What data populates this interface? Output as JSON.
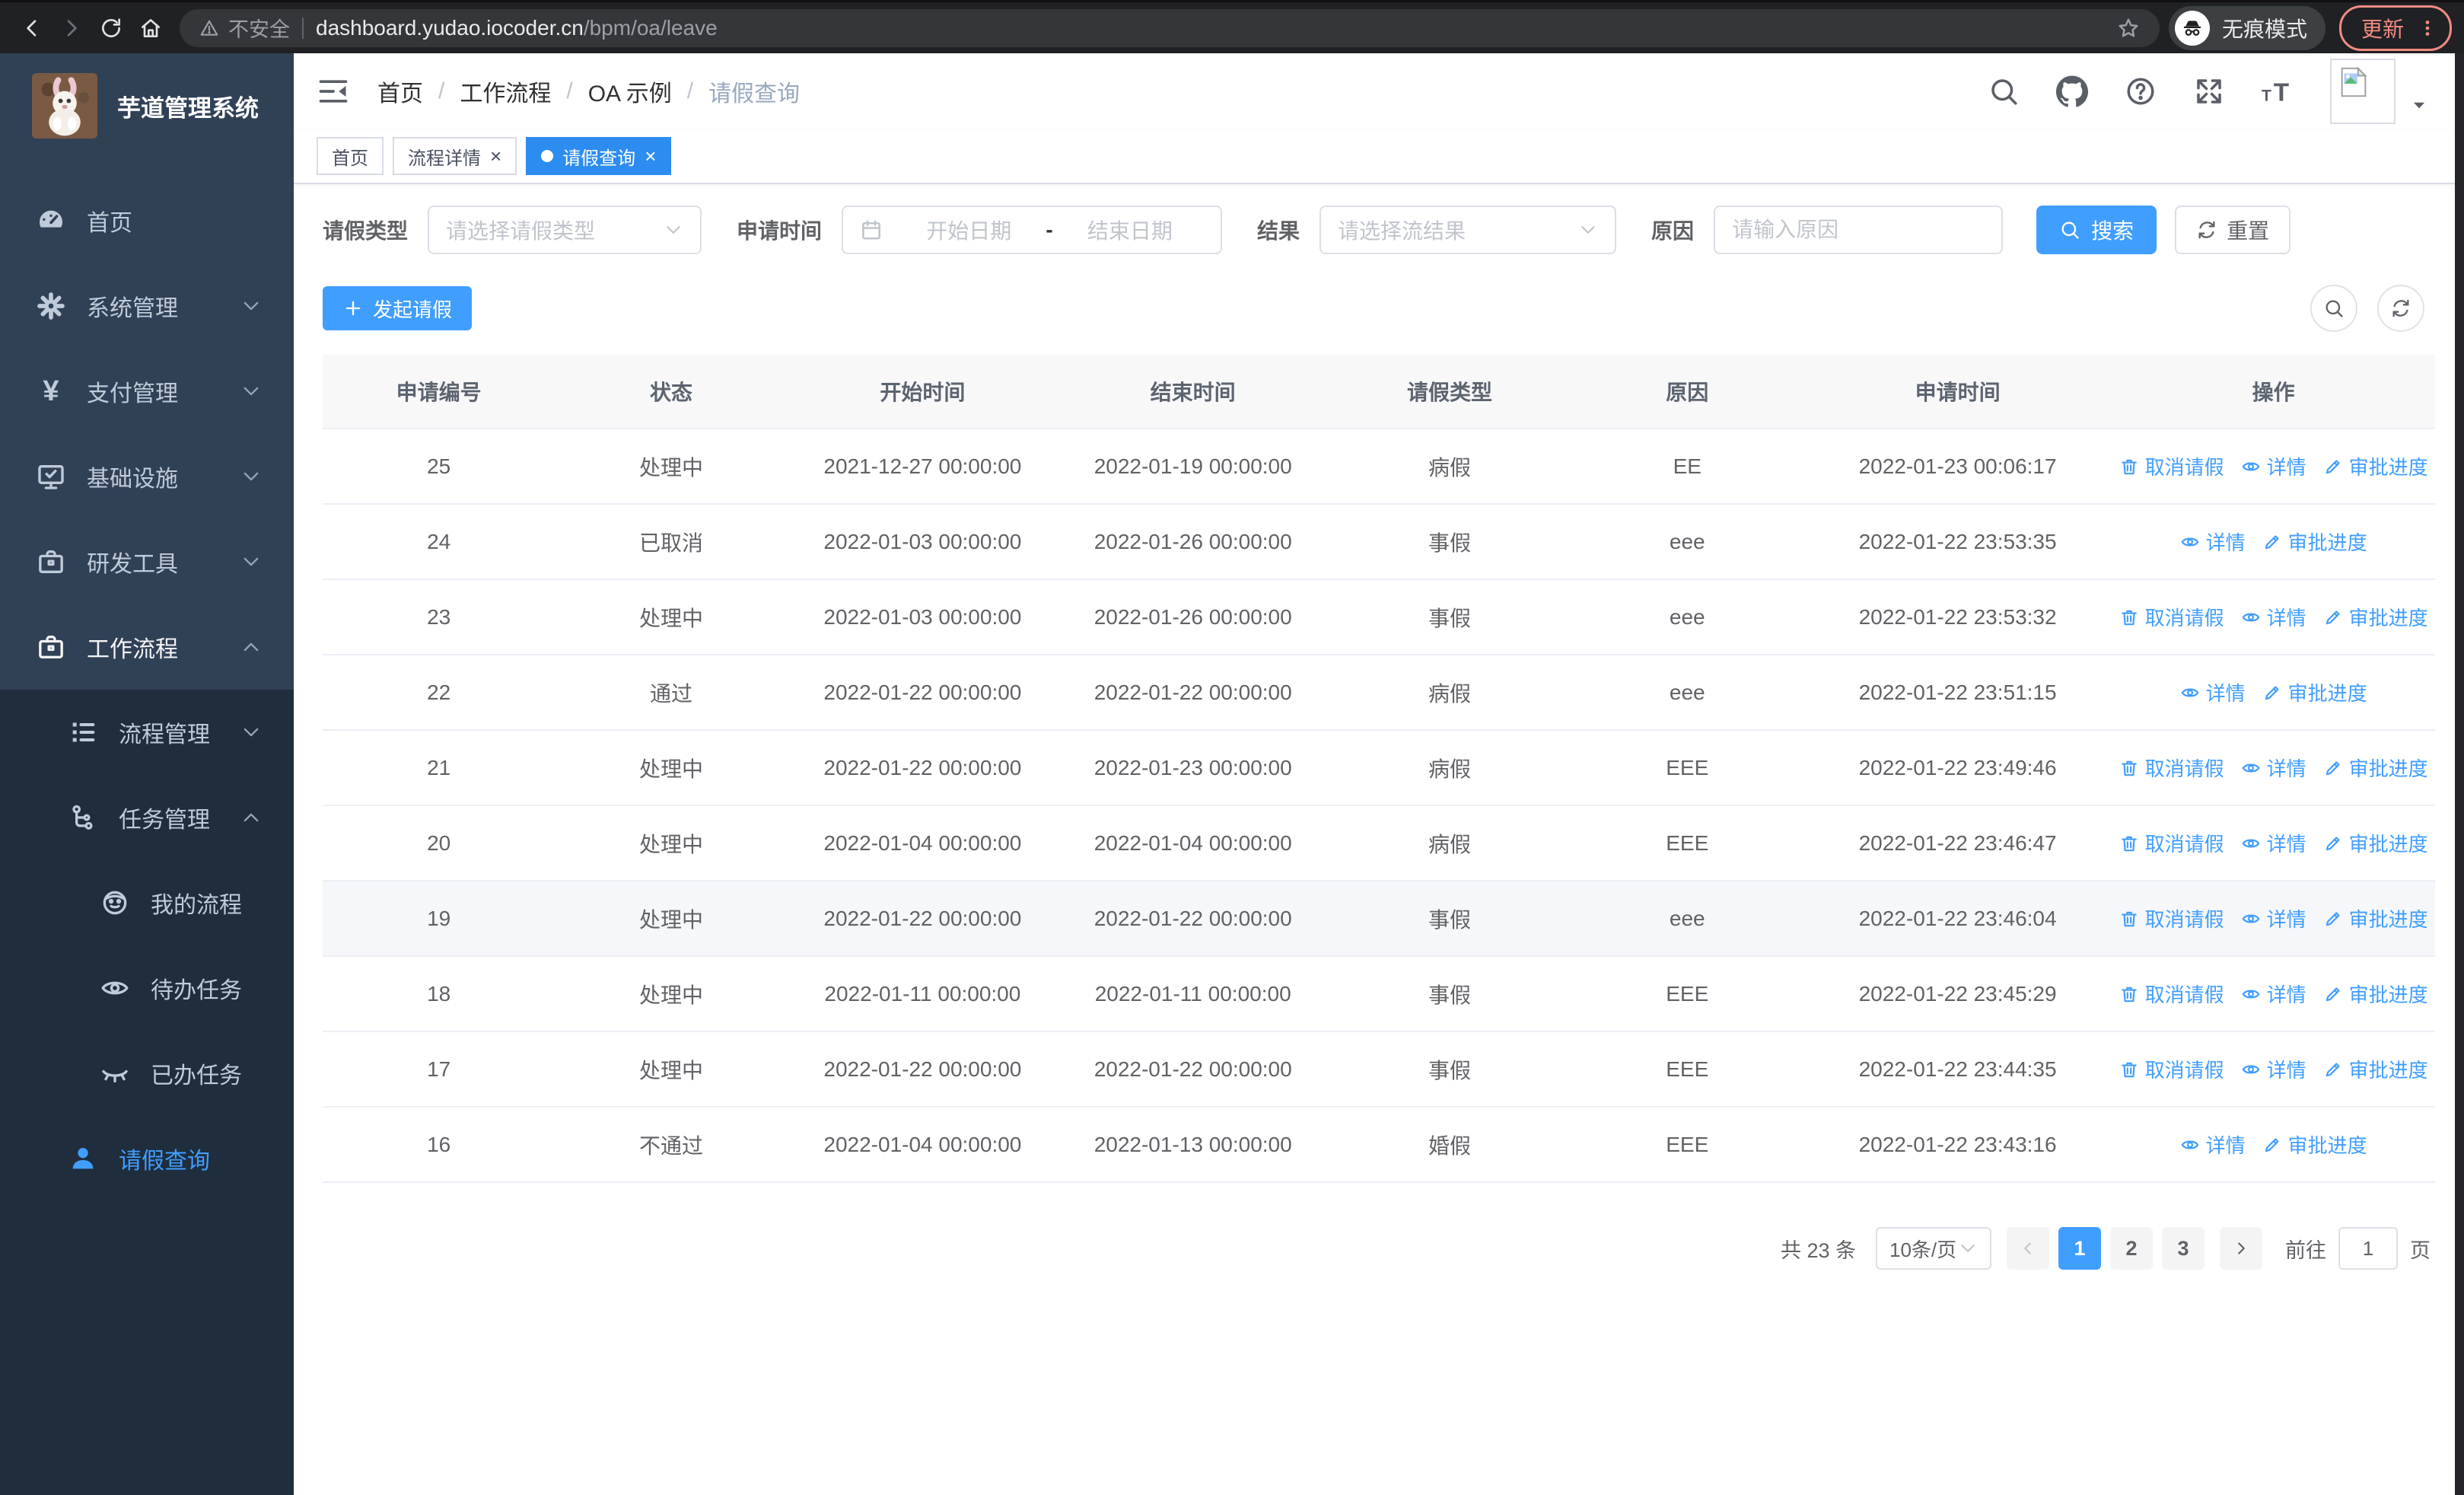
{
  "browser": {
    "security_label": "不安全",
    "url_domain": "dashboard.yudao.iocoder.cn",
    "url_path": "/bpm/oa/leave",
    "incognito_label": "无痕模式",
    "update_label": "更新",
    "left_icons": [
      "back-icon",
      "forward-icon",
      "reload-icon",
      "home-icon"
    ]
  },
  "colors": {
    "primary": "#409eff",
    "update_accent": "#f28b82",
    "sidebar_bg": "#304156",
    "submenu_bg": "#1f2d3d"
  },
  "sidebar": {
    "app_title": "芋道管理系统",
    "items": [
      {
        "label": "首页",
        "icon": "dashboard-icon",
        "level": 0,
        "arrow": null,
        "sub": false,
        "active": false
      },
      {
        "label": "系统管理",
        "icon": "gear-icon",
        "level": 0,
        "arrow": "down",
        "sub": false,
        "active": false
      },
      {
        "label": "支付管理",
        "icon": "yen-icon",
        "level": 0,
        "arrow": "down",
        "sub": false,
        "active": false
      },
      {
        "label": "基础设施",
        "icon": "monitor-icon",
        "level": 0,
        "arrow": "down",
        "sub": false,
        "active": false
      },
      {
        "label": "研发工具",
        "icon": "briefcase-icon",
        "level": 0,
        "arrow": "down",
        "sub": false,
        "active": false
      },
      {
        "label": "工作流程",
        "icon": "briefcase-icon",
        "level": 0,
        "arrow": "up",
        "sub": false,
        "active": false,
        "bright": true
      },
      {
        "label": "流程管理",
        "icon": "list-icon",
        "level": 1,
        "arrow": "down",
        "sub": true,
        "active": false
      },
      {
        "label": "任务管理",
        "icon": "flow-icon",
        "level": 1,
        "arrow": "up",
        "sub": true,
        "active": false
      },
      {
        "label": "我的流程",
        "icon": "face-icon",
        "level": 2,
        "arrow": null,
        "sub": true,
        "active": false
      },
      {
        "label": "待办任务",
        "icon": "eye-icon",
        "level": 2,
        "arrow": null,
        "sub": true,
        "active": false
      },
      {
        "label": "已办任务",
        "icon": "eye-closed-icon",
        "level": 2,
        "arrow": null,
        "sub": true,
        "active": false
      },
      {
        "label": "请假查询",
        "icon": "user-icon",
        "level": 1,
        "arrow": null,
        "sub": true,
        "active": true
      }
    ]
  },
  "header": {
    "breadcrumb": [
      "首页",
      "工作流程",
      "OA 示例",
      "请假查询"
    ],
    "right_icons": [
      "search-icon",
      "github-icon",
      "question-icon",
      "fullscreen-icon",
      "font-size-icon"
    ]
  },
  "tabs": [
    {
      "label": "首页",
      "active": false,
      "closable": false
    },
    {
      "label": "流程详情",
      "active": false,
      "closable": true
    },
    {
      "label": "请假查询",
      "active": true,
      "closable": true
    }
  ],
  "filters": {
    "type_label": "请假类型",
    "type_placeholder": "请选择请假类型",
    "time_label": "申请时间",
    "start_placeholder": "开始日期",
    "range_separator": "-",
    "end_placeholder": "结束日期",
    "result_label": "结果",
    "result_placeholder": "请选择流结果",
    "reason_label": "原因",
    "reason_placeholder": "请输入原因",
    "search_label": "搜索",
    "reset_label": "重置"
  },
  "toolbar": {
    "create_label": "发起请假"
  },
  "table": {
    "headers": [
      "申请编号",
      "状态",
      "开始时间",
      "结束时间",
      "请假类型",
      "原因",
      "申请时间",
      "操作"
    ],
    "action_defs": {
      "cancel": {
        "label": "取消请假",
        "icon": "delete-icon"
      },
      "detail": {
        "label": "详情",
        "icon": "view-icon"
      },
      "progress": {
        "label": "审批进度",
        "icon": "edit-icon"
      }
    },
    "rows": [
      {
        "id": "25",
        "status": "处理中",
        "start": "2021-12-27 00:00:00",
        "end": "2022-01-19 00:00:00",
        "type": "病假",
        "reason": "EE",
        "applied": "2022-01-23 00:06:17",
        "actions": [
          "cancel",
          "detail",
          "progress"
        ],
        "hover": false
      },
      {
        "id": "24",
        "status": "已取消",
        "start": "2022-01-03 00:00:00",
        "end": "2022-01-26 00:00:00",
        "type": "事假",
        "reason": "eee",
        "applied": "2022-01-22 23:53:35",
        "actions": [
          "detail",
          "progress"
        ],
        "hover": false
      },
      {
        "id": "23",
        "status": "处理中",
        "start": "2022-01-03 00:00:00",
        "end": "2022-01-26 00:00:00",
        "type": "事假",
        "reason": "eee",
        "applied": "2022-01-22 23:53:32",
        "actions": [
          "cancel",
          "detail",
          "progress"
        ],
        "hover": false
      },
      {
        "id": "22",
        "status": "通过",
        "start": "2022-01-22 00:00:00",
        "end": "2022-01-22 00:00:00",
        "type": "病假",
        "reason": "eee",
        "applied": "2022-01-22 23:51:15",
        "actions": [
          "detail",
          "progress"
        ],
        "hover": false
      },
      {
        "id": "21",
        "status": "处理中",
        "start": "2022-01-22 00:00:00",
        "end": "2022-01-23 00:00:00",
        "type": "病假",
        "reason": "EEE",
        "applied": "2022-01-22 23:49:46",
        "actions": [
          "cancel",
          "detail",
          "progress"
        ],
        "hover": false
      },
      {
        "id": "20",
        "status": "处理中",
        "start": "2022-01-04 00:00:00",
        "end": "2022-01-04 00:00:00",
        "type": "病假",
        "reason": "EEE",
        "applied": "2022-01-22 23:46:47",
        "actions": [
          "cancel",
          "detail",
          "progress"
        ],
        "hover": false
      },
      {
        "id": "19",
        "status": "处理中",
        "start": "2022-01-22 00:00:00",
        "end": "2022-01-22 00:00:00",
        "type": "事假",
        "reason": "eee",
        "applied": "2022-01-22 23:46:04",
        "actions": [
          "cancel",
          "detail",
          "progress"
        ],
        "hover": true
      },
      {
        "id": "18",
        "status": "处理中",
        "start": "2022-01-11 00:00:00",
        "end": "2022-01-11 00:00:00",
        "type": "事假",
        "reason": "EEE",
        "applied": "2022-01-22 23:45:29",
        "actions": [
          "cancel",
          "detail",
          "progress"
        ],
        "hover": false
      },
      {
        "id": "17",
        "status": "处理中",
        "start": "2022-01-22 00:00:00",
        "end": "2022-01-22 00:00:00",
        "type": "事假",
        "reason": "EEE",
        "applied": "2022-01-22 23:44:35",
        "actions": [
          "cancel",
          "detail",
          "progress"
        ],
        "hover": false
      },
      {
        "id": "16",
        "status": "不通过",
        "start": "2022-01-04 00:00:00",
        "end": "2022-01-13 00:00:00",
        "type": "婚假",
        "reason": "EEE",
        "applied": "2022-01-22 23:43:16",
        "actions": [
          "detail",
          "progress"
        ],
        "hover": false
      }
    ]
  },
  "pagination": {
    "total_label": "共 23 条",
    "page_size": "10条/页",
    "pages": [
      "1",
      "2",
      "3"
    ],
    "active_page": "1",
    "goto_label": "前往",
    "goto_value": "1",
    "page_unit": "页"
  }
}
